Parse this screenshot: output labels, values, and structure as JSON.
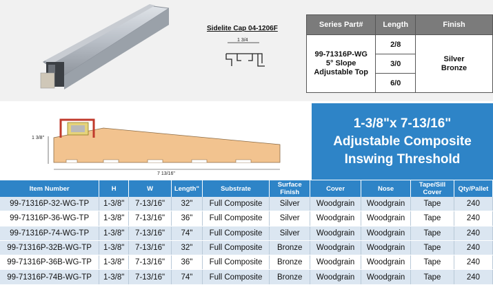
{
  "sidelite_title": "Sidelite Cap 04-1206F",
  "sidelite_dim": "1 3/4",
  "series_table": {
    "headers": [
      "Series Part#",
      "Length",
      "Finish"
    ],
    "part_lines": [
      "99-71316P-WG",
      "5° Slope",
      "Adjustable Top"
    ],
    "lengths": [
      "2/8",
      "3/0",
      "6/0"
    ],
    "finishes": [
      "Silver",
      "Bronze"
    ]
  },
  "cross_section": {
    "height_label": "1 3/8\"",
    "width_label": "7 13/16\""
  },
  "headline": [
    "1-3/8\"x 7-13/16\"",
    "Adjustable Composite",
    "Inswing Threshold"
  ],
  "main_table": {
    "headers": [
      "Item Number",
      "H",
      "W",
      "Length\"",
      "Substrate",
      "Surface Finish",
      "Cover",
      "Nose",
      "Tape/Sill Cover",
      "Qty/Pallet"
    ],
    "rows": [
      [
        "99-71316P-32-WG-TP",
        "1-3/8\"",
        "7-13/16\"",
        "32\"",
        "Full Composite",
        "Silver",
        "Woodgrain",
        "Woodgrain",
        "Tape",
        "240"
      ],
      [
        "99-71316P-36-WG-TP",
        "1-3/8\"",
        "7-13/16\"",
        "36\"",
        "Full Composite",
        "Silver",
        "Woodgrain",
        "Woodgrain",
        "Tape",
        "240"
      ],
      [
        "99-71316P-74-WG-TP",
        "1-3/8\"",
        "7-13/16\"",
        "74\"",
        "Full Composite",
        "Silver",
        "Woodgrain",
        "Woodgrain",
        "Tape",
        "240"
      ],
      [
        "99-71316P-32B-WG-TP",
        "1-3/8\"",
        "7-13/16\"",
        "32\"",
        "Full Composite",
        "Bronze",
        "Woodgrain",
        "Woodgrain",
        "Tape",
        "240"
      ],
      [
        "99-71316P-36B-WG-TP",
        "1-3/8\"",
        "7-13/16\"",
        "36\"",
        "Full Composite",
        "Bronze",
        "Woodgrain",
        "Woodgrain",
        "Tape",
        "240"
      ],
      [
        "99-71316P-74B-WG-TP",
        "1-3/8\"",
        "7-13/16\"",
        "74\"",
        "Full Composite",
        "Bronze",
        "Woodgrain",
        "Woodgrain",
        "Tape",
        "240"
      ]
    ]
  },
  "colors": {
    "header_blue": "#2e84c7",
    "row_tint": "#dbe6f1",
    "series_header_grey": "#7b7b7b",
    "composite_tan": "#f2c38f",
    "cap_red": "#c0392b"
  }
}
